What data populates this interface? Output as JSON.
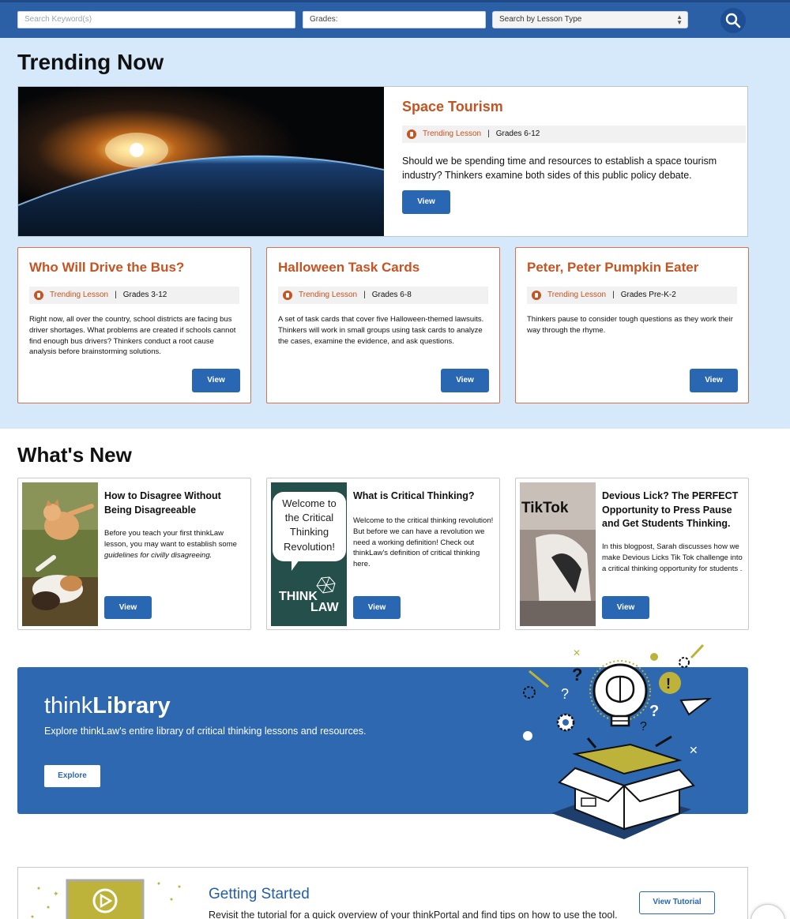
{
  "search": {
    "keyword_placeholder": "Search Keyword(s)",
    "grades_label": "Grades:",
    "lesson_type_selected": "Search by Lesson Type"
  },
  "trending": {
    "heading": "Trending Now",
    "featured": {
      "title": "Space Tourism",
      "kind": "Trending Lesson",
      "grades": "Grades 6-12",
      "description": "Should we be spending time and resources to establish a space tourism industry? Thinkers examine both sides of this public policy debate.",
      "view_label": "View"
    },
    "cards": [
      {
        "title": "Who Will Drive the Bus?",
        "kind": "Trending Lesson",
        "grades": "Grades 3-12",
        "description": "Right now, all over the country, school districts are facing bus driver shortages. What problems are created if schools cannot find enough bus drivers? Thinkers conduct a root cause analysis before brainstorming solutions.",
        "view_label": "View"
      },
      {
        "title": "Halloween Task Cards",
        "kind": "Trending Lesson",
        "grades": "Grades 6-8",
        "description": "A set of task cards that cover five Halloween-themed lawsuits. Thinkers will work in small groups using task cards to analyze the cases, examine the evidence, and ask questions.",
        "view_label": "View"
      },
      {
        "title": "Peter, Peter Pumpkin Eater",
        "kind": "Trending Lesson",
        "grades": "Grades Pre-K-2",
        "description": "Thinkers pause to consider tough questions as they work their way through the rhyme.",
        "view_label": "View"
      }
    ]
  },
  "whats_new": {
    "heading": "What's New",
    "cards": [
      {
        "title": "How to Disagree Without Being Disagreeable",
        "description": "Before you teach your first thinkLaw lesson, you may want to establish some",
        "description_italic": "guidelines for civilly disagreeing.",
        "view_label": "View"
      },
      {
        "title": "What is Critical Thinking?",
        "description": "Welcome to the critical thinking revolution! But before we can have a revolution we need a working definition! Check out thinkLaw's definition of critical thinking here.",
        "view_label": "View",
        "thumb_text": "Welcome to the Critical Thinking Revolution!",
        "thumb_logo_top": "THINK",
        "thumb_logo_bottom": "LAW"
      },
      {
        "title": "Devious Lick? The PERFECT Opportunity to Press Pause and Get Students Thinking.",
        "description": "In this blogpost, Sarah discusses how we make Devious Licks Tik Tok challenge into a critical thinking opportunity for students .",
        "view_label": "View",
        "thumb_text": "TikTok"
      }
    ]
  },
  "library": {
    "title_light": "think",
    "title_bold": "Library",
    "description": "Explore thinkLaw's entire library of critical thinking lessons and resources.",
    "explore_label": "Explore"
  },
  "getting_started": {
    "title": "Getting Started",
    "description": "Revisit the tutorial for a quick overview of your thinkPortal and find tips on how to use the tool.",
    "button_label": "View Tutorial"
  },
  "colors": {
    "brand_blue": "#2a67b3",
    "accent_orange": "#c65321",
    "trending_bg": "#d6e9fb"
  }
}
